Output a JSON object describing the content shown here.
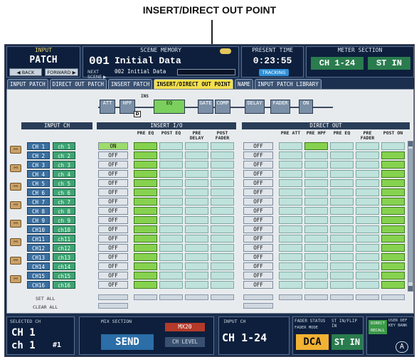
{
  "caption": "INSERT/DIRECT OUT POINT",
  "header": {
    "input_label": "INPUT",
    "patch_label": "PATCH",
    "back_label": "◀ BACK",
    "forward_label": "FORWARD ▶",
    "scene_memory_label": "SCENE MEMORY",
    "scene_number": "001",
    "scene_name": "Initial Data",
    "next_scene_label": "NEXT SCENE ▶",
    "next_scene": "002 Initial Data",
    "present_time_label": "PRESENT TIME",
    "present_time": "0:23:55",
    "tracking_label": "TRACKING",
    "meter_section_label": "METER SECTION",
    "meter_range": "CH 1-24",
    "meter_st": "ST IN"
  },
  "tabs": [
    {
      "label": "INPUT PATCH",
      "active": false
    },
    {
      "label": "DIRECT OUT PATCH",
      "active": false
    },
    {
      "label": "INSERT PATCH",
      "active": false
    },
    {
      "label": "INSERT/DIRECT OUT POINT",
      "active": true
    },
    {
      "label": "NAME",
      "active": false
    },
    {
      "label": "INPUT PATCH LIBRARY",
      "active": false
    }
  ],
  "flow": {
    "att": "ATT",
    "hpf": "HPF",
    "ins": "INS",
    "eq": "EQ",
    "gate": "GATE",
    "comp": "COMP",
    "delay": "DELAY",
    "fader": "FADER",
    "on": "ON",
    "d_label": "D"
  },
  "panels": {
    "input_ch": "INPUT CH",
    "insert_io": "INSERT I/O",
    "direct_out": "DIRECT OUT"
  },
  "insert_headers": [
    "PRE EQ",
    "POST EQ",
    "PRE DELAY",
    "POST FADER"
  ],
  "direct_headers": [
    "PRE ATT",
    "PRE HPF",
    "PRE EQ",
    "PRE FADER",
    "POST ON"
  ],
  "channels": [
    {
      "ch": "CH 1",
      "name": "ch 1",
      "insert_on": "ON",
      "direct_on": "OFF"
    },
    {
      "ch": "CH 2",
      "name": "ch 2",
      "insert_on": "OFF",
      "direct_on": "OFF"
    },
    {
      "ch": "CH 3",
      "name": "ch 3",
      "insert_on": "OFF",
      "direct_on": "OFF"
    },
    {
      "ch": "CH 4",
      "name": "ch 4",
      "insert_on": "OFF",
      "direct_on": "OFF"
    },
    {
      "ch": "CH 5",
      "name": "ch 5",
      "insert_on": "OFF",
      "direct_on": "OFF"
    },
    {
      "ch": "CH 6",
      "name": "ch 6",
      "insert_on": "OFF",
      "direct_on": "OFF"
    },
    {
      "ch": "CH 7",
      "name": "ch 7",
      "insert_on": "OFF",
      "direct_on": "OFF"
    },
    {
      "ch": "CH 8",
      "name": "ch 8",
      "insert_on": "OFF",
      "direct_on": "OFF"
    },
    {
      "ch": "CH 9",
      "name": "ch 9",
      "insert_on": "OFF",
      "direct_on": "OFF"
    },
    {
      "ch": "CH10",
      "name": "ch10",
      "insert_on": "OFF",
      "direct_on": "OFF"
    },
    {
      "ch": "CH11",
      "name": "ch11",
      "insert_on": "OFF",
      "direct_on": "OFF"
    },
    {
      "ch": "CH12",
      "name": "ch12",
      "insert_on": "OFF",
      "direct_on": "OFF"
    },
    {
      "ch": "CH13",
      "name": "ch13",
      "insert_on": "OFF",
      "direct_on": "OFF"
    },
    {
      "ch": "CH14",
      "name": "ch14",
      "insert_on": "OFF",
      "direct_on": "OFF"
    },
    {
      "ch": "CH15",
      "name": "ch15",
      "insert_on": "OFF",
      "direct_on": "OFF"
    },
    {
      "ch": "CH16",
      "name": "ch16",
      "insert_on": "OFF",
      "direct_on": "OFF"
    }
  ],
  "footer": {
    "set_all": "SET ALL",
    "clear_all": "CLEAR ALL"
  },
  "bottom": {
    "selected_label": "SELECTED CH",
    "selected_ch": "CH 1",
    "selected_name": "ch 1",
    "mix_section_label": "MIX SECTION",
    "mix_number": "#1",
    "mix_bus": "MX20",
    "send_label": "SEND",
    "level_label": "CH LEVEL",
    "input_ch_label": "INPUT CH",
    "input_ch_range": "CH 1-24",
    "fader_status_label": "FADER STATUS",
    "fader_mode": "FADER MODE",
    "dca_label": "DCA",
    "st_in_flip_label": "ST IN/FLIP IN",
    "st_in": "ST IN",
    "direct_recall_label": "DIRECT RECALL",
    "user_def_label": "USER DEF KEY BANK",
    "ab_label": "A"
  },
  "colors": {
    "active_tab": "#f3df4e",
    "insert_selected": "#86d24f",
    "on_button": "#9ddc6b",
    "screen_bg": "#13294d"
  }
}
